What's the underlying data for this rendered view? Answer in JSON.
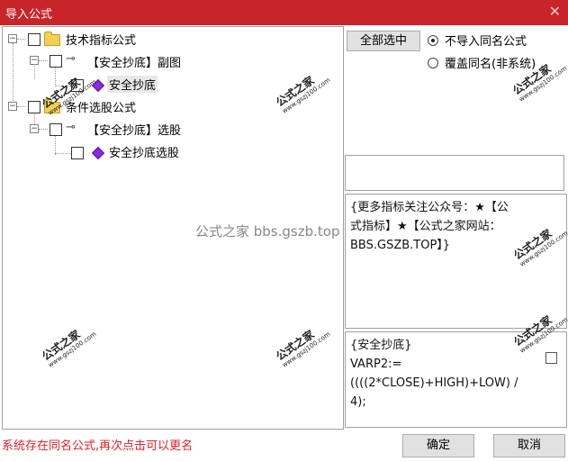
{
  "window": {
    "title": "导入公式",
    "close_icon": "close-icon"
  },
  "tree": {
    "nodes": [
      {
        "label": "技术指标公式",
        "icon": "folder-icon"
      },
      {
        "label": "【安全抄底】副图",
        "icon": "key-icon"
      },
      {
        "label": "安全抄底",
        "icon": "gem-icon"
      },
      {
        "label": "条件选股公式",
        "icon": "folder-icon"
      },
      {
        "label": "【安全抄底】选股",
        "icon": "key-icon"
      },
      {
        "label": "安全抄底选股",
        "icon": "gem-icon"
      }
    ]
  },
  "controls": {
    "select_all": "全部选中",
    "radio_skip": "不导入同名公式",
    "radio_overwrite": "覆盖同名(非系统)"
  },
  "info": {
    "lines": [
      "{更多指标关注公众号：★【公",
      "式指标】★【公式之家网站：",
      "BBS.GSZB.TOP】}"
    ]
  },
  "code": {
    "lines": [
      "{安全抄底}",
      "VARP2:=",
      "((((2*CLOSE)+HIGH)+LOW) /",
      "4);"
    ]
  },
  "watermark": {
    "brand": "公式之家",
    "url": "www.gszj100.com",
    "center": "公式之家 bbs.gszb.top"
  },
  "status": {
    "message": "系统存在同名公式,再次点击可以更名"
  },
  "footer": {
    "ok": "确定",
    "cancel": "取消"
  },
  "colors": {
    "title_bar": "#c8252b",
    "status_text": "#e0202a"
  }
}
